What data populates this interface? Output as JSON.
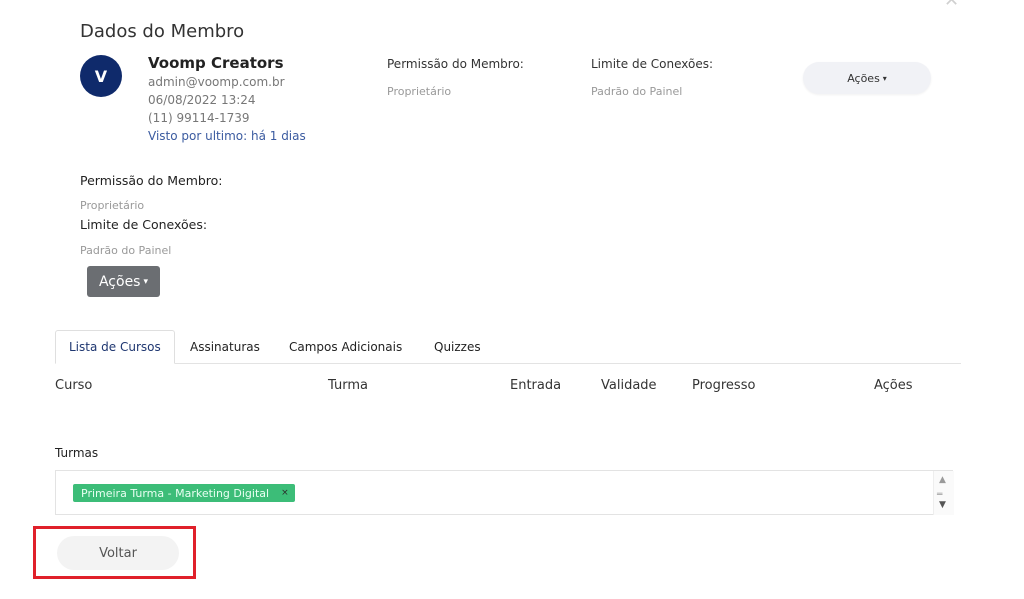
{
  "modal": {
    "close_icon": "close-icon",
    "title": "Dados do Membro"
  },
  "member": {
    "avatar_letter": "V",
    "name": "Voomp Creators",
    "email": "admin@voomp.com.br",
    "date": "06/08/2022 13:24",
    "phone": "(11) 99114-1739",
    "last_seen": "Visto por ultimo: há 1 dias"
  },
  "header": {
    "permission_label": "Permissão do Membro:",
    "permission_value": "Proprietário",
    "limit_label": "Limite de Conexões:",
    "limit_value": "Padrão do Painel",
    "actions_label": "Ações",
    "caret": "▾"
  },
  "details": {
    "permission_label": "Permissão do Membro:",
    "permission_value": "Proprietário",
    "limit_label": "Limite de Conexões:",
    "limit_value": "Padrão do Painel",
    "actions_label": "Ações",
    "caret": "▾"
  },
  "tabs": [
    {
      "label": "Lista de Cursos",
      "active": true
    },
    {
      "label": "Assinaturas",
      "active": false
    },
    {
      "label": "Campos Adicionais",
      "active": false
    },
    {
      "label": "Quizzes",
      "active": false
    }
  ],
  "table": {
    "columns": [
      "Curso",
      "Turma",
      "Entrada",
      "Validade",
      "Progresso",
      "Ações"
    ]
  },
  "turmas": {
    "label": "Turmas",
    "selected": [
      {
        "label": "Primeira Turma - Marketing Digital",
        "remove": "×"
      }
    ]
  },
  "footer": {
    "back_label": "Voltar"
  },
  "colors": {
    "accent": "#0f2a6b",
    "link": "#3b5ba0",
    "tag_bg": "#3cbd78",
    "highlight": "#e0202a"
  }
}
